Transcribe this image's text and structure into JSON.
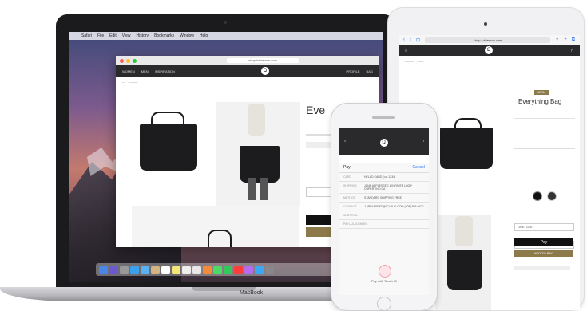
{
  "mac": {
    "label": "MacBook",
    "menubar": [
      "Safari",
      "File",
      "Edit",
      "View",
      "History",
      "Bookmarks",
      "Window",
      "Help"
    ],
    "url": "shop.lululemon.com",
    "nav": [
      "WOMEN",
      "MEN",
      "INSPIRATION"
    ],
    "nav_right": [
      "PROFILE",
      "BAG"
    ],
    "logo_glyph": "Ω",
    "product_title": "Eve"
  },
  "ipad": {
    "url": "shop.lululemon.com",
    "product_title": "Everything Bag",
    "badge": "NEW",
    "apple_pay_label": "Pay",
    "add_to_bag_label": "ADD TO BAG",
    "size_label": "ONE SIZE",
    "logo_glyph": "Ω"
  },
  "iphone": {
    "pay_title": "Pay",
    "cancel_label": "Cancel",
    "rows": [
      {
        "k": "Card",
        "v": "HELLO CARD (•••• 1234)"
      },
      {
        "k": "Shipping",
        "v": "JANE APPLESEED 1 INFINITE LOOP CUPERTINO CA"
      },
      {
        "k": "Method",
        "v": "STANDARD SHIPPING FREE"
      },
      {
        "k": "Contact",
        "v": "J.APPLESEED@ICLOUD.COM (408) 555-0100"
      },
      {
        "k": "Subtotal",
        "v": ""
      },
      {
        "k": "Pay Lululemon",
        "v": ""
      }
    ],
    "touch_label": "Pay with Touch ID"
  },
  "colors": {
    "dark_nav": "#2a2a2c",
    "gold": "#8c7a4b",
    "apple_blue": "#2b7bf6"
  }
}
